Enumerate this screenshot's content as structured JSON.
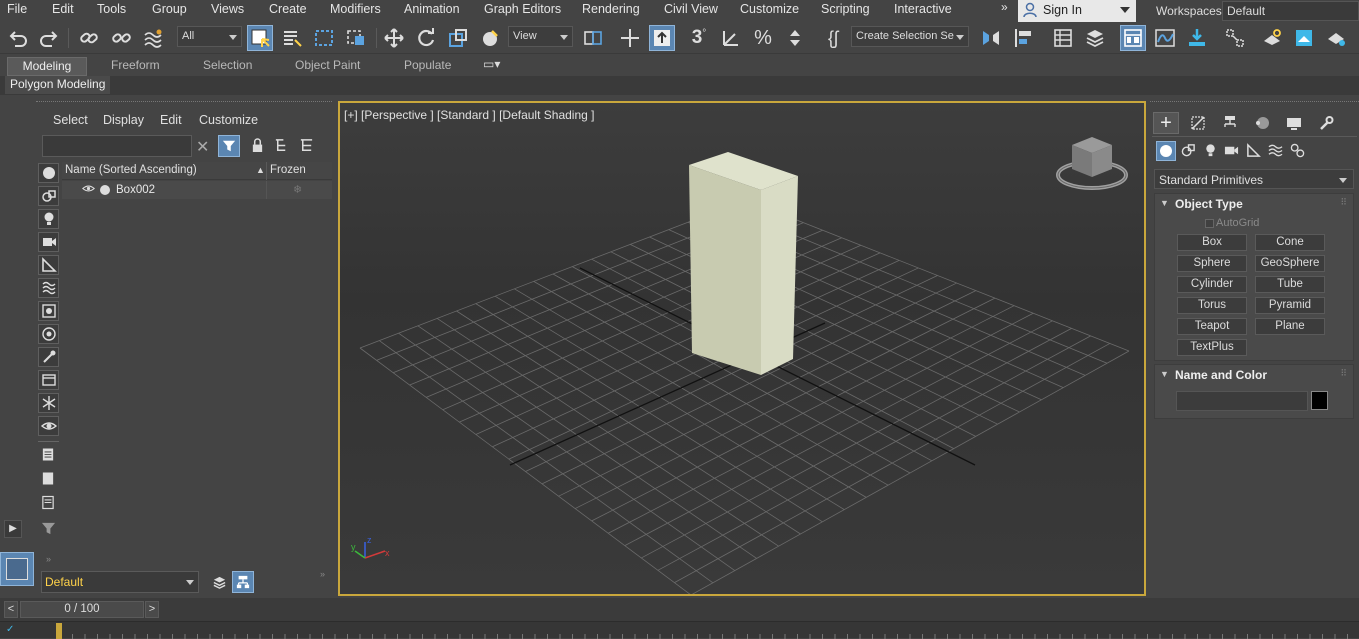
{
  "menubar": {
    "items": [
      "File",
      "Edit",
      "Tools",
      "Group",
      "Views",
      "Create",
      "Modifiers",
      "Animation",
      "Graph Editors",
      "Rendering",
      "Civil View",
      "Customize",
      "Scripting",
      "Interactive"
    ],
    "signin_label": "Sign In",
    "workspaces_label": "Workspaces:",
    "workspace_value": "Default"
  },
  "toolbar": {
    "selection_filter": "All",
    "ref_coord": "View",
    "named_selection": "Create Selection Se"
  },
  "ribbon": {
    "tabs": [
      "Modeling",
      "Freeform",
      "Selection",
      "Object Paint",
      "Populate"
    ],
    "panel_label": "Polygon Modeling"
  },
  "scene_explorer": {
    "menu": [
      "Select",
      "Display",
      "Edit",
      "Customize"
    ],
    "search_value": "",
    "col_name": "Name (Sorted Ascending)",
    "col_frozen": "Frozen",
    "rows": [
      {
        "name": "Box002"
      }
    ],
    "layer": "Default"
  },
  "viewport": {
    "label": "[+] [Perspective ] [Standard ] [Default Shading ]",
    "axis_x": "x",
    "axis_y": "y",
    "axis_z": "z"
  },
  "command_panel": {
    "category": "Standard Primitives",
    "object_type_title": "Object Type",
    "autogrid": "AutoGrid",
    "buttons": [
      "Box",
      "Cone",
      "Sphere",
      "GeoSphere",
      "Cylinder",
      "Tube",
      "Torus",
      "Pyramid",
      "Teapot",
      "Plane",
      "TextPlus"
    ],
    "name_color_title": "Name and Color",
    "object_color": "#000000"
  },
  "timeline": {
    "frame": "0 / 100",
    "prev": "<",
    "next": ">"
  },
  "colors": {
    "accent": "#5b86b2",
    "viewport_border": "#c9a73c",
    "layer_text": "#ffd34a",
    "box_light": "#d6d9c2",
    "box_dark": "#b0b49a"
  }
}
